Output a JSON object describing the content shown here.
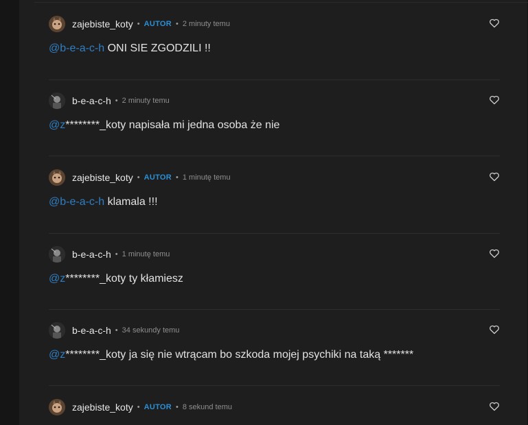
{
  "comments": [
    {
      "username": "zajebiste_koty",
      "badge": "AUTOR",
      "separator": "•",
      "time": "2 minuty temu",
      "mention": "@b-e-a-c-h",
      "text": " ONI SIE ZGODZILI !!",
      "avatar": "cat-avatar"
    },
    {
      "username": "b-e-a-c-h",
      "badge": "",
      "separator": "•",
      "time": "2 minuty temu",
      "mention": "@z",
      "text": "********_koty napisała mi jedna osoba że nie",
      "avatar": "dark-avatar"
    },
    {
      "username": "zajebiste_koty",
      "badge": "AUTOR",
      "separator": "•",
      "time": "1 minutę temu",
      "mention": "@b-e-a-c-h",
      "text": " klamala !!!",
      "avatar": "cat-avatar"
    },
    {
      "username": "b-e-a-c-h",
      "badge": "",
      "separator": "•",
      "time": "1 minutę temu",
      "mention": "@z",
      "text": "********_koty ty kłamiesz",
      "avatar": "dark-avatar"
    },
    {
      "username": "b-e-a-c-h",
      "badge": "",
      "separator": "•",
      "time": "34 sekundy temu",
      "mention": "@z",
      "text": "********_koty ja się nie wtrącam bo szkoda mojej psychiki na taką *******",
      "avatar": "dark-avatar"
    },
    {
      "username": "zajebiste_koty",
      "badge": "AUTOR",
      "separator": "•",
      "time": "8 sekund temu",
      "mention": "",
      "text": "",
      "avatar": "cat-avatar"
    }
  ],
  "icons": {
    "like": "heart-outline-icon"
  },
  "colors": {
    "mention": "#2f7fc4",
    "badge": "#2b8fd6",
    "background": "#1e1e1e"
  }
}
